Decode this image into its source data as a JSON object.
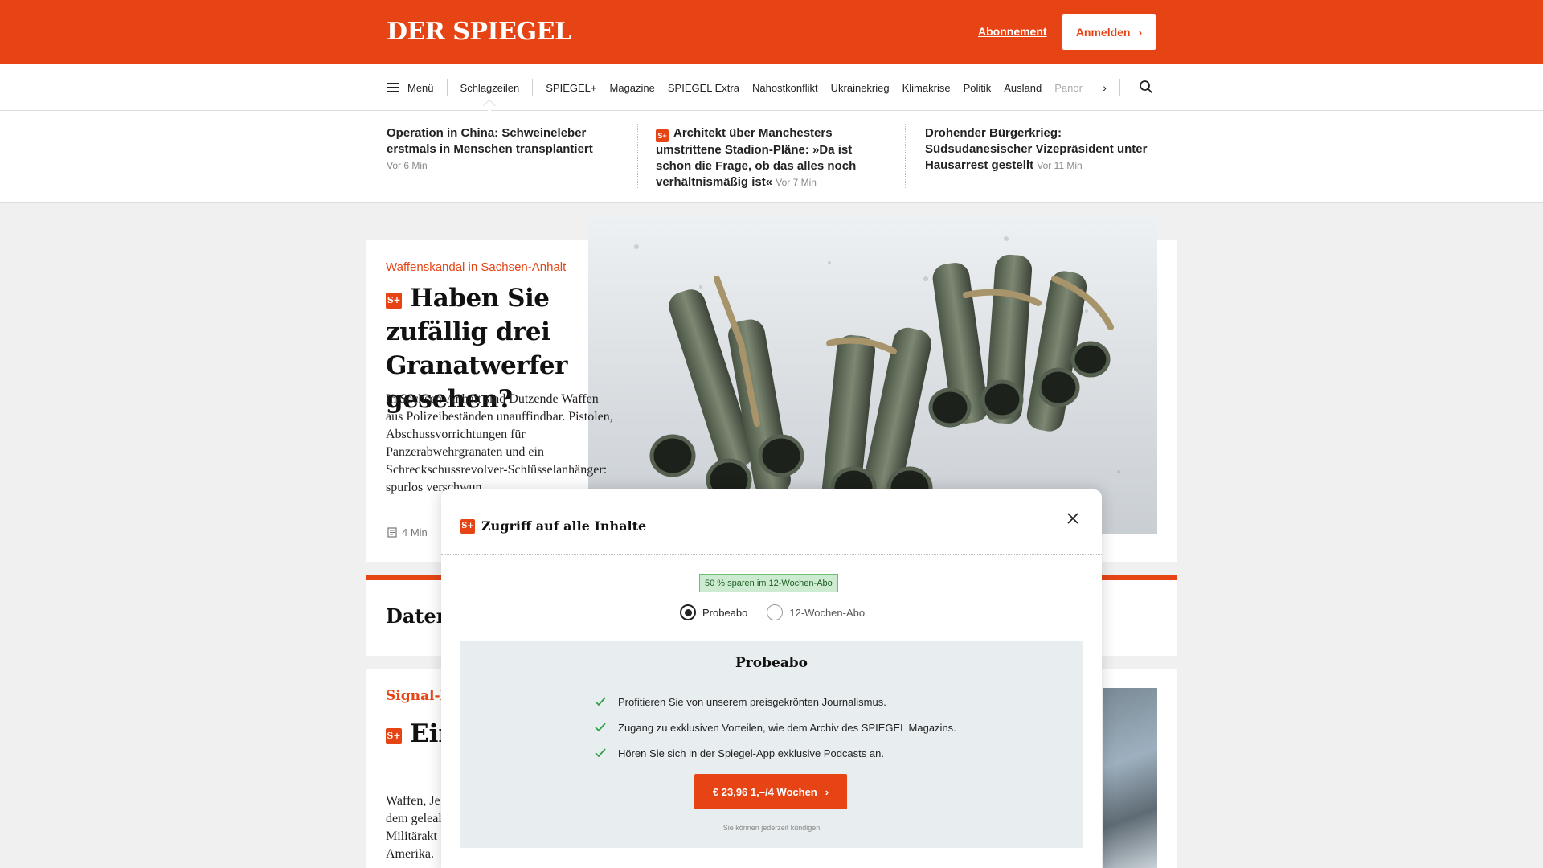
{
  "header": {
    "logo": "DER SPIEGEL",
    "abo_link": "Abonnement",
    "login_label": "Anmelden",
    "brand_color": "#e64415"
  },
  "nav": {
    "menu_label": "Menü",
    "items": [
      "Schlagzeilen",
      "SPIEGEL+",
      "Magazine",
      "SPIEGEL Extra",
      "Nahostkonflikt",
      "Ukrainekrieg",
      "Klimakrise",
      "Politik",
      "Ausland"
    ],
    "truncated_item": "Panor",
    "icons": [
      "hamburger-icon",
      "chevron-right-icon",
      "search-icon"
    ]
  },
  "ticker": [
    {
      "title": "Operation in China: Schweineleber erstmals in Menschen transplantiert",
      "time": "Vor 6 Min",
      "plus": false
    },
    {
      "title": "Architekt über Manchesters umstrittene Stadion-Pläne: »Da ist schon die Frage, ob das alles noch verhältnismäßig ist«",
      "time": "Vor 7 Min",
      "plus": true
    },
    {
      "title": "Drohender Bürgerkrieg: Südsudanesischer Vizepräsident unter Hausarrest gestellt",
      "time": "Vor 11 Min",
      "plus": false
    }
  ],
  "lead": {
    "kicker": "Waffenskandal in Sachsen-Anhalt",
    "headline": "Haben Sie zufällig drei Granatwerfer gesehen?",
    "text": "In Sachsen-Anhalt sind Dutzende Waffen aus Polizeibeständen unauffindbar. Pistolen, Abschussvorrichtungen für Panzerabwehrgranaten und ein Schreckschussrevolver-Schlüsselanhänger: spurlos verschwun",
    "read_time": "4 Min",
    "plus_badge": "S+"
  },
  "second": {
    "title": "Datenc"
  },
  "third": {
    "kicker": "Signal-Pa",
    "headline": "Ein aus e",
    "text_lines": [
      "Waffen, Je",
      "dem geleal",
      "Militärakt",
      "Amerika."
    ]
  },
  "modal": {
    "title": "Zugriff auf alle Inhalte",
    "save_badge": "50 % sparen im 12-Wochen-Abo",
    "options": [
      "Probeabo",
      "12-Wochen-Abo"
    ],
    "selected_option": "Probeabo",
    "plan_title": "Probeabo",
    "benefits": [
      "Profitieren Sie von unserem preisgekrönten Journalismus.",
      "Zugang zu exklusiven Vorteilen, wie dem Archiv des SPIEGEL Magazins.",
      "Hören Sie sich in der Spiegel-App exklusive Podcasts an."
    ],
    "cta_old_price": "€ 23,96",
    "cta_new_price": "1,–/4 Wochen",
    "cancel_note": "Sie können jederzeit kündigen",
    "accent_green": "#2ea043"
  }
}
